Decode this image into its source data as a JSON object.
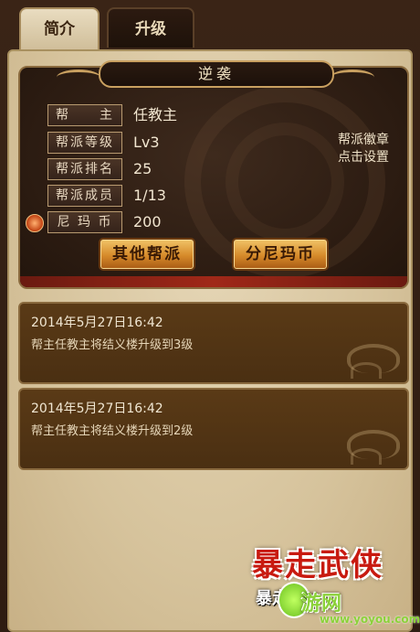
{
  "tabs": [
    {
      "label": "简介",
      "active": true
    },
    {
      "label": "升级",
      "active": false
    }
  ],
  "guild": {
    "name": "逆袭",
    "badge_hint_line1": "帮派徽章",
    "badge_hint_line2": "点击设置",
    "rows": [
      {
        "label": "帮　　主",
        "value": "任教主"
      },
      {
        "label": "帮派等级",
        "value": "Lv3"
      },
      {
        "label": "帮派排名",
        "value": "25"
      },
      {
        "label": "帮派成员",
        "value": "1/13"
      },
      {
        "label": "尼 玛 币",
        "value": "200",
        "icon": "coin-icon"
      }
    ],
    "buttons": {
      "other_guilds": "其他帮派",
      "give_coins": "分尼玛币"
    }
  },
  "news": [
    {
      "time": "2014年5月27日16:42",
      "text": "帮主任教主将结义楼升级到3级"
    },
    {
      "time": "2014年5月27日16:42",
      "text": "帮主任教主将结义楼升级到2级"
    }
  ],
  "watermark": {
    "title": "暴走武侠",
    "sub": "暴走",
    "site": "游网",
    "url": "www.yoyou.com"
  },
  "colors": {
    "accent_gold": "#d68a2a",
    "parchment": "#d6c39c",
    "panel_dark": "#2b1b11",
    "news_bg": "#4a2f12"
  }
}
